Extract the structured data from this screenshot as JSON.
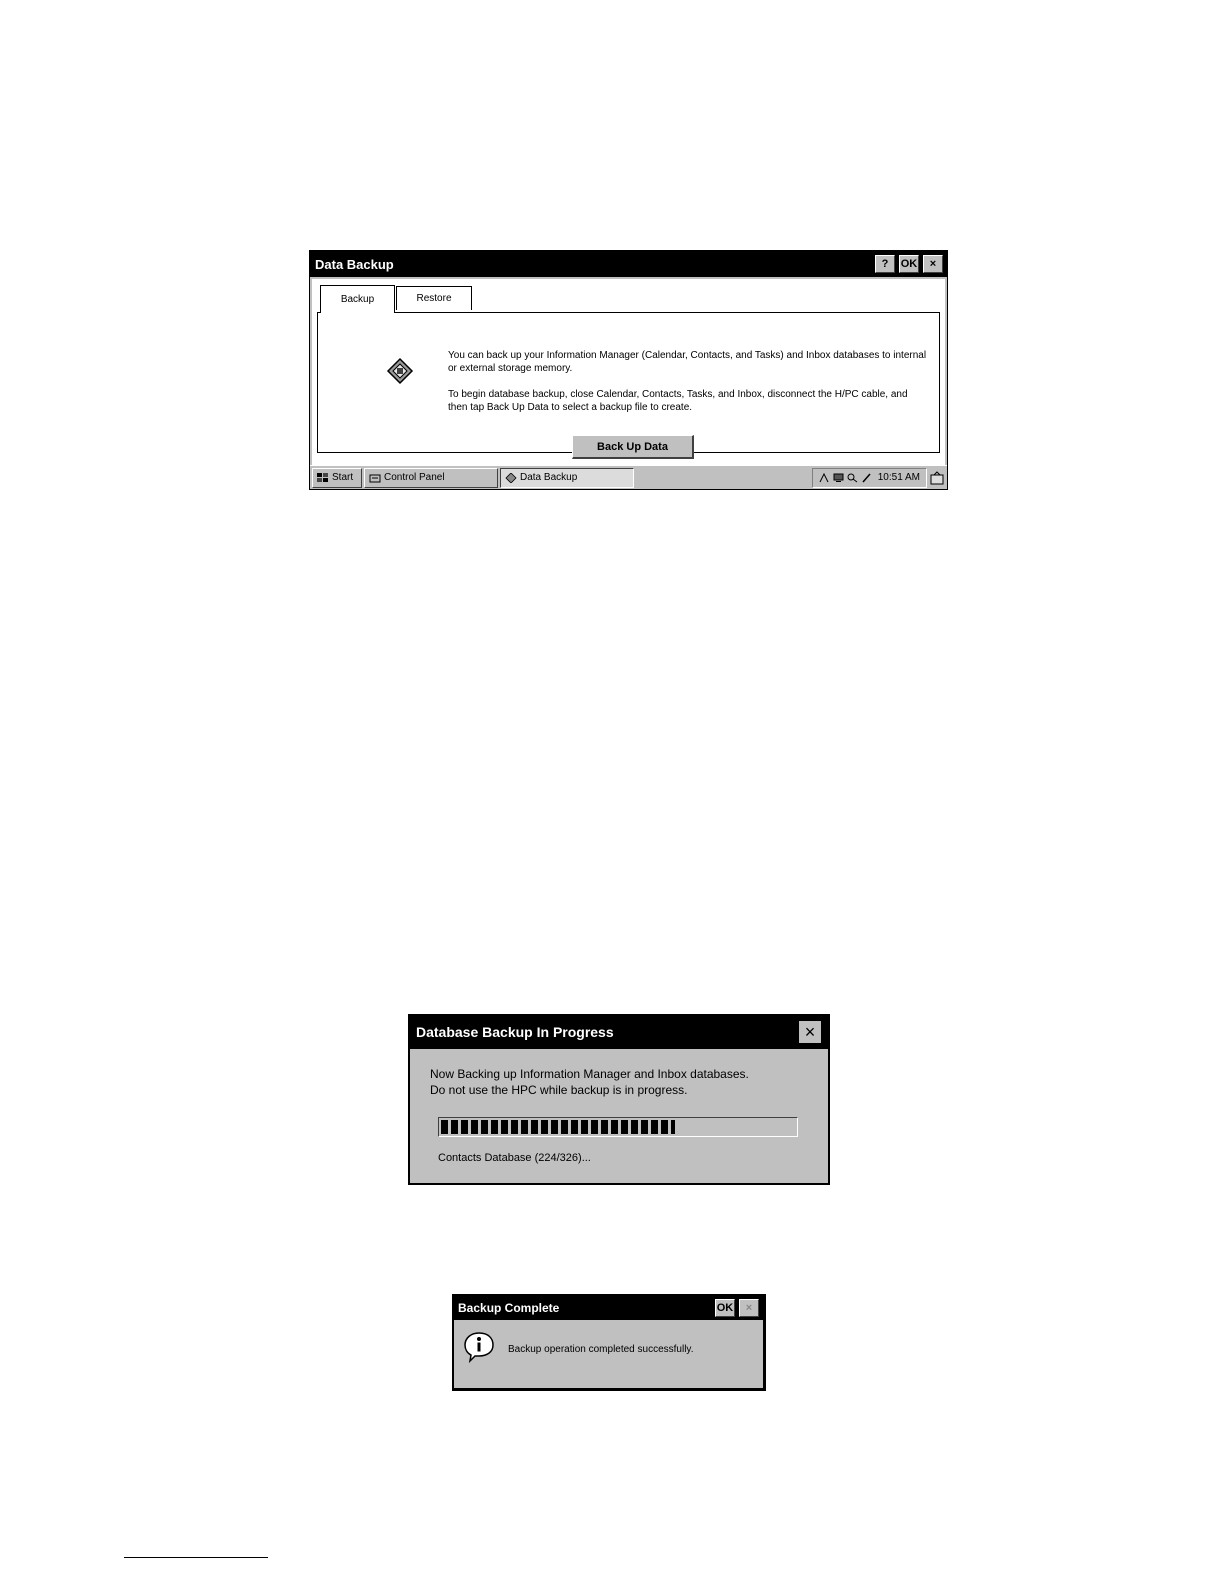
{
  "data_backup_window": {
    "title": "Data Backup",
    "help_button": "?",
    "ok_button": "OK",
    "close_button": "×",
    "tabs": [
      {
        "label": "Backup",
        "active": true
      },
      {
        "label": "Restore",
        "active": false
      }
    ],
    "paragraph_1": "You can back up your Information Manager (Calendar, Contacts, and Tasks) and Inbox databases to internal or external storage memory.",
    "paragraph_2": "To begin database backup, close Calendar, Contacts, Tasks, and Inbox, disconnect the H/PC cable, and then tap Back Up Data to select a backup file to create.",
    "action_button": "Back Up Data"
  },
  "taskbar": {
    "start_label": "Start",
    "tasks": [
      {
        "label": "Control Panel",
        "pressed": false
      },
      {
        "label": "Data Backup",
        "pressed": true
      }
    ],
    "clock": "10:51 AM",
    "tray_icons": [
      "connection-icon",
      "pc-link-icon",
      "search-icon",
      "pen-icon"
    ]
  },
  "progress_dialog": {
    "title": "Database Backup In Progress",
    "close_button": "×",
    "message_line_1": "Now Backing up Information Manager and Inbox databases.",
    "message_line_2": "Do not use the HPC while backup is in progress.",
    "progress_fraction": 0.66,
    "status": "Contacts Database (224/326)..."
  },
  "complete_dialog": {
    "title": "Backup Complete",
    "ok_button": "OK",
    "close_button": "×",
    "message": "Backup operation completed successfully."
  },
  "colors": {
    "titlebar": "#000000",
    "window_face": "#c0c0c0",
    "client": "#ffffff"
  }
}
